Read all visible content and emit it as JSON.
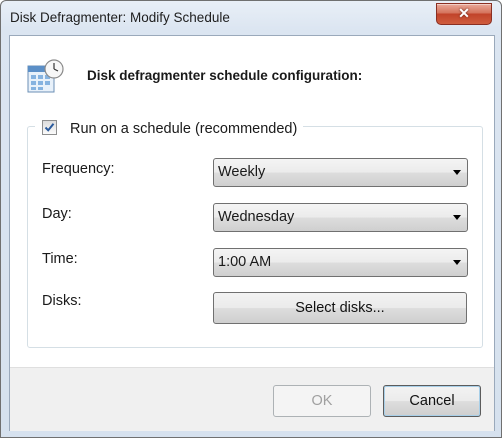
{
  "window": {
    "title": "Disk Defragmenter: Modify Schedule",
    "close_glyph": "✕"
  },
  "header": {
    "text": "Disk defragmenter schedule configuration:",
    "icon": "calendar-clock-icon"
  },
  "schedule": {
    "checkbox_label": "Run on a schedule (recommended)",
    "checked": true,
    "frequency_label": "Frequency:",
    "frequency_value": "Weekly",
    "day_label": "Day:",
    "day_value": "Wednesday",
    "time_label": "Time:",
    "time_value": "1:00 AM",
    "disks_label": "Disks:",
    "select_disks_label": "Select disks..."
  },
  "footer": {
    "ok_label": "OK",
    "cancel_label": "Cancel"
  },
  "colors": {
    "accent": "#2a5a9c",
    "close": "#c1432a",
    "footer_bg": "#f0f0f0"
  }
}
